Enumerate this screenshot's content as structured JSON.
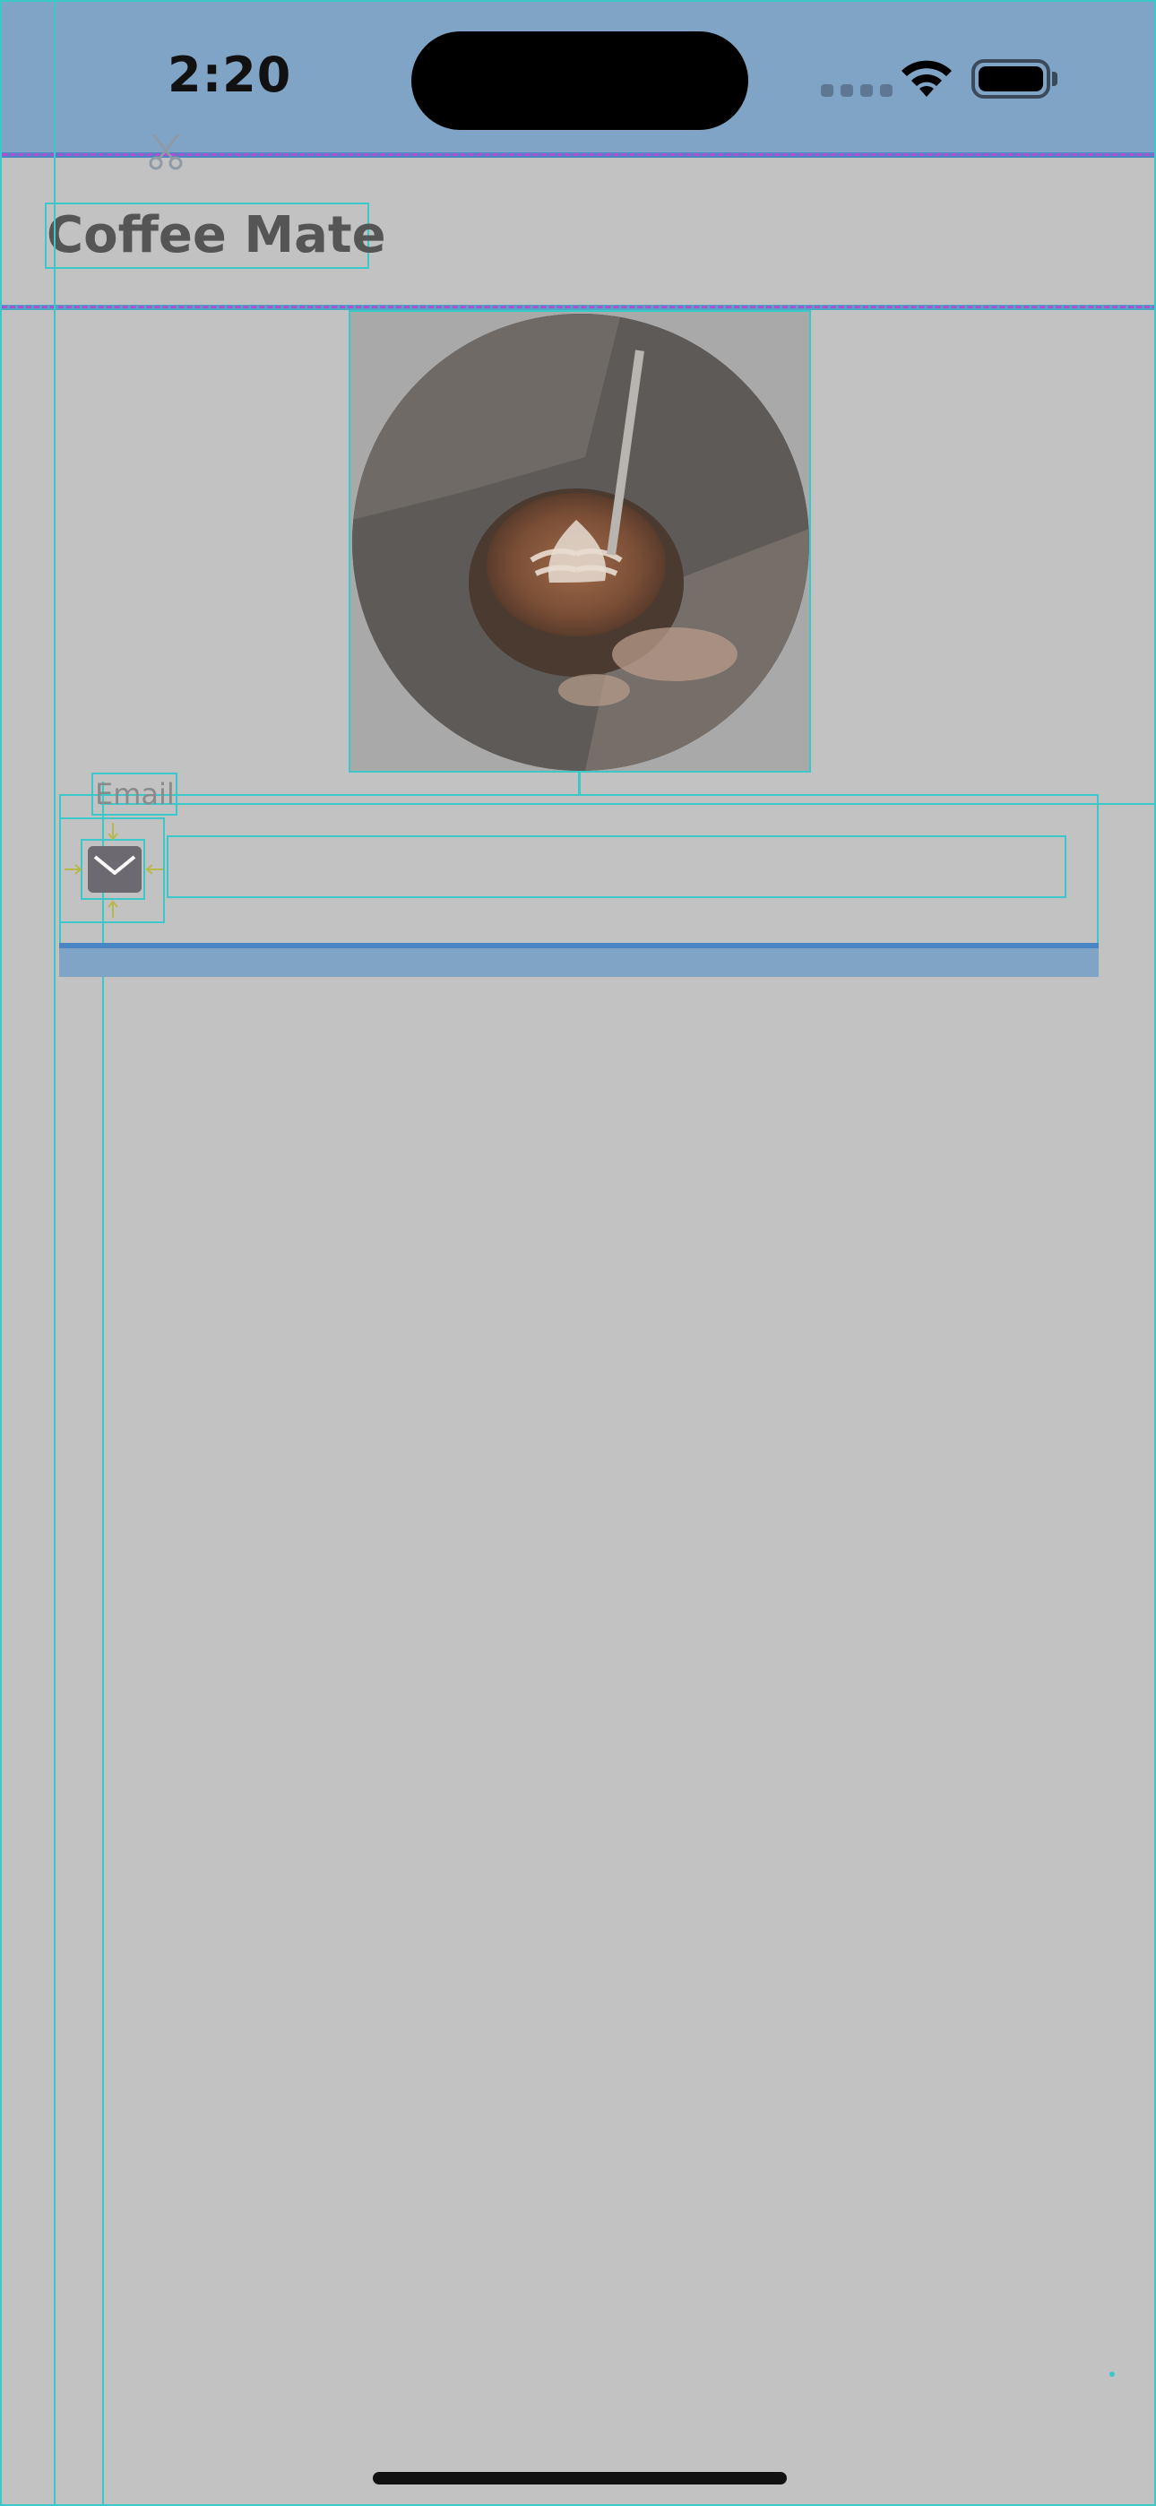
{
  "status_bar": {
    "time": "2:20"
  },
  "header": {
    "title": "Coffee Mate"
  },
  "hero": {
    "image_label": "latte-art-coffee-cup"
  },
  "form": {
    "email_label": "Email",
    "email_value": "",
    "email_placeholder": ""
  },
  "icons": {
    "status": [
      "cellular-signal-icon",
      "wifi-icon",
      "battery-icon"
    ],
    "header": "scissors-icon",
    "email": "mail-icon"
  },
  "colors": {
    "background": "#c2c2c2",
    "status_bar": "#7fa4c6",
    "title_text": "#555555",
    "guide_line": "#3cc8c8",
    "accent_underline": "#4a86c4"
  }
}
